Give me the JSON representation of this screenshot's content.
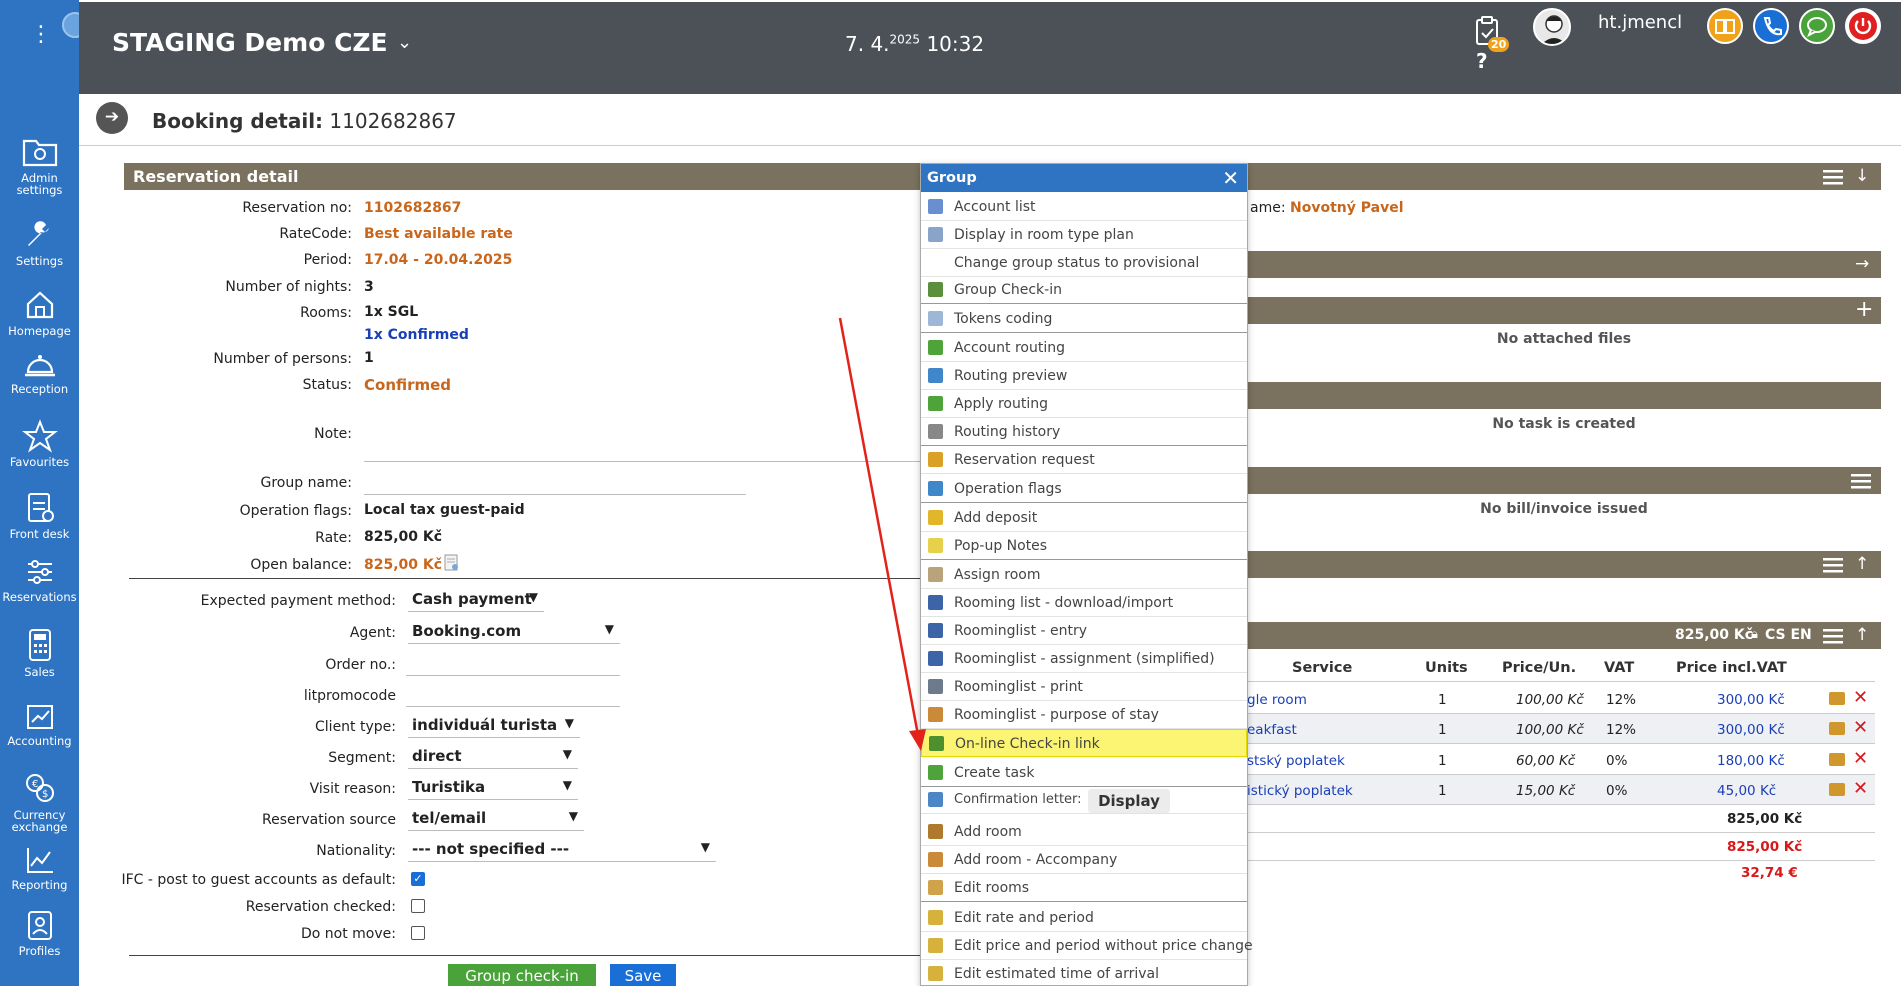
{
  "topbar": {
    "title": "STAGING Demo CZE",
    "date": "7. 4.",
    "date_sup": "2025",
    "time": "10:32",
    "notifications_count": "20",
    "username": "ht.jmencl"
  },
  "sidebar": {
    "items": [
      {
        "label1": "Admin",
        "label2": "settings",
        "icon": "admin-folder-icon"
      },
      {
        "label1": "Settings",
        "label2": "",
        "icon": "wrench-icon"
      },
      {
        "label1": "Homepage",
        "label2": "",
        "icon": "home-icon"
      },
      {
        "label1": "Reception",
        "label2": "",
        "icon": "bell-icon"
      },
      {
        "label1": "Favourites",
        "label2": "",
        "icon": "star-icon"
      },
      {
        "label1": "Front desk",
        "label2": "",
        "icon": "clipboard-icon"
      },
      {
        "label1": "Reservations",
        "label2": "",
        "icon": "sliders-icon"
      },
      {
        "label1": "Sales",
        "label2": "",
        "icon": "calculator-icon"
      },
      {
        "label1": "Accounting",
        "label2": "",
        "icon": "accounting-icon"
      },
      {
        "label1": "Currency",
        "label2": "exchange",
        "icon": "currency-icon"
      },
      {
        "label1": "Reporting",
        "label2": "",
        "icon": "chart-icon"
      },
      {
        "label1": "Profiles",
        "label2": "",
        "icon": "profiles-icon"
      }
    ]
  },
  "header": {
    "label": "Booking detail:",
    "number": "1102682867"
  },
  "reservation": {
    "section_title": "Reservation detail",
    "fields": {
      "reservation_no_label": "Reservation no:",
      "reservation_no": "1102682867",
      "ratecode_label": "RateCode:",
      "ratecode": "Best available rate",
      "period_label": "Period:",
      "period": "17.04 - 20.04.2025",
      "nights_label": "Number of nights:",
      "nights": "3",
      "rooms_label": "Rooms:",
      "rooms": "1x SGL",
      "rooms_confirmed": "1x Confirmed",
      "persons_label": "Number of persons:",
      "persons": "1",
      "status_label": "Status:",
      "status": "Confirmed",
      "note_label": "Note:",
      "group_name_label": "Group name:",
      "flags_label": "Operation flags:",
      "flags": "Local tax guest-paid",
      "rate_label": "Rate:",
      "rate": "825,00 Kč",
      "open_balance_label": "Open balance:",
      "open_balance": "825,00 Kč"
    },
    "form": {
      "payment_label": "Expected payment method:",
      "payment": "Cash payment",
      "agent_label": "Agent:",
      "agent": "Booking.com",
      "order_label": "Order no.:",
      "promocode_label": "litpromocode",
      "client_type_label": "Client type:",
      "client_type": "individuál turista",
      "segment_label": "Segment:",
      "segment": "direct",
      "visit_label": "Visit reason:",
      "visit": "Turistika",
      "source_label": "Reservation source",
      "source": "tel/email",
      "nationality_label": "Nationality:",
      "nationality": "--- not specified ---",
      "ifc_label": "IFC - post to guest accounts as default:",
      "ifc_checked": true,
      "checked_label": "Reservation checked:",
      "checked": false,
      "donotmove_label": "Do not move:",
      "donotmove": false
    },
    "buttons": {
      "group_checkin": "Group check-in",
      "save": "Save"
    }
  },
  "right": {
    "name_label_partial": "ame:",
    "name": "Novotný Pavel",
    "no_files": "No attached files",
    "no_task": "No task is created",
    "no_bill": "No bill/invoice issued",
    "account_total": "825,00 Kč",
    "languages": "CS EN",
    "table": {
      "headers": [
        "Service",
        "Units",
        "Price/Un.",
        "VAT",
        "Price incl.VAT"
      ],
      "rows": [
        {
          "service": "gle room",
          "units": "1",
          "price": "100,00 Kč",
          "vat": "12%",
          "total": "300,00 Kč"
        },
        {
          "service": "eakfast",
          "units": "1",
          "price": "100,00 Kč",
          "vat": "12%",
          "total": "300,00 Kč"
        },
        {
          "service": "stský poplatek",
          "units": "1",
          "price": "60,00 Kč",
          "vat": "0%",
          "total": "180,00 Kč"
        },
        {
          "service": "istický poplatek",
          "units": "1",
          "price": "15,00 Kč",
          "vat": "0%",
          "total": "45,00 Kč"
        }
      ],
      "sum1": "825,00 Kč",
      "sum2": "825,00 Kč",
      "sum3": "32,74 €"
    }
  },
  "group_menu": {
    "title": "Group",
    "items": [
      {
        "label": "Account list",
        "color": "#6a8fd1"
      },
      {
        "label": "Display in room type plan",
        "color": "#8aa3c9"
      },
      {
        "label": "Change group status to provisional",
        "color": "#ffffff"
      },
      {
        "label": "Group Check-in",
        "color": "#5b8f3e"
      },
      {
        "label": "Tokens coding",
        "color": "#9fb7d6"
      },
      {
        "label": "Account routing",
        "color": "#4ea33a"
      },
      {
        "label": "Routing preview",
        "color": "#3f87c8"
      },
      {
        "label": "Apply routing",
        "color": "#4ea33a"
      },
      {
        "label": "Routing history",
        "color": "#888888"
      },
      {
        "label": "Reservation request",
        "color": "#d9a227"
      },
      {
        "label": "Operation flags",
        "color": "#3f87c8"
      },
      {
        "label": "Add deposit",
        "color": "#e2b62b"
      },
      {
        "label": "Pop-up Notes",
        "color": "#e8d14a"
      },
      {
        "label": "Assign room",
        "color": "#b8a37a"
      },
      {
        "label": "Rooming list - download/import",
        "color": "#3e64a8"
      },
      {
        "label": "Roominglist - entry",
        "color": "#3e64a8"
      },
      {
        "label": "Roominglist - assignment (simplified)",
        "color": "#3e64a8"
      },
      {
        "label": "Roominglist - print",
        "color": "#6c7a8c"
      },
      {
        "label": "Roominglist - purpose of stay",
        "color": "#c98a3a"
      },
      {
        "label": "On-line Check-in link",
        "color": "#4e8f2e"
      },
      {
        "label": "Create task",
        "color": "#4ea33a"
      },
      {
        "label": "Confirmation letter:",
        "color": "#4d86c4"
      },
      {
        "label": "Add room",
        "color": "#b07a2e"
      },
      {
        "label": "Add room - Accompany",
        "color": "#c98a3a"
      },
      {
        "label": "Edit rooms",
        "color": "#d0a34a"
      },
      {
        "label": "Edit rate and period",
        "color": "#d6b13c"
      },
      {
        "label": "Edit price and period without price change",
        "color": "#d6b13c"
      },
      {
        "label": "Edit estimated time of arrival",
        "color": "#d6b13c"
      }
    ],
    "display_button": "Display"
  },
  "colors": {
    "sidebar": "#2e74c3",
    "topbar": "#4c5157",
    "section_bar": "#7a715e",
    "accent_orange": "#c8661c",
    "highlight": "#fbf573",
    "annotation_arrow": "#e2231a"
  }
}
